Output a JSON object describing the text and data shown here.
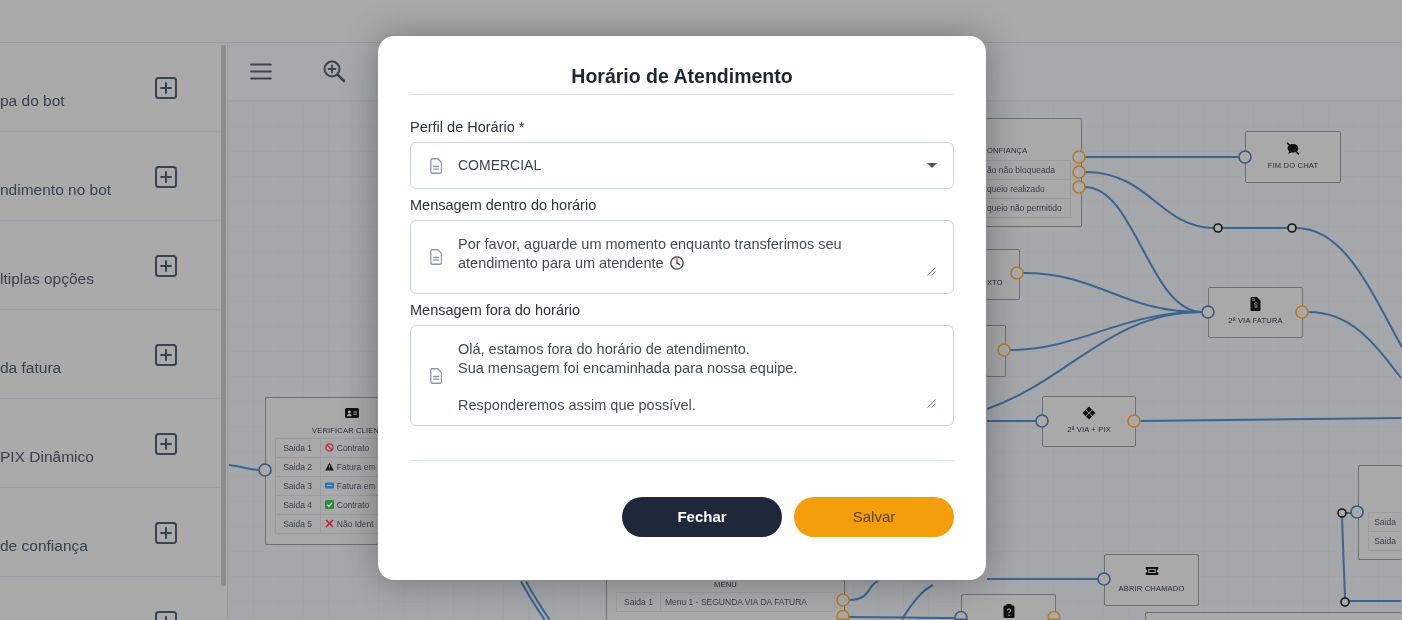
{
  "sidebar": {
    "items": [
      {
        "label": "pa do bot",
        "add_button": true
      },
      {
        "label": "ndimento no bot",
        "add_button": true
      },
      {
        "label": "ltiplas opções",
        "add_button": true
      },
      {
        "label": "da fatura",
        "add_button": true
      },
      {
        "label": "PIX Dinâmico",
        "add_button": true
      },
      {
        "label": "de confiança",
        "add_button": true
      },
      {
        "add_button": true
      }
    ]
  },
  "diagram": {
    "nodes": [
      {
        "kind": "table",
        "title": "ONFIANÇA",
        "rows": [
          {
            "text": "ão não bloqueada"
          },
          {
            "text": "queio realizado"
          },
          {
            "text": "queio não permitido"
          }
        ]
      },
      {
        "kind": "action",
        "title": "FIM DO CHAT"
      },
      {
        "kind": "action",
        "title": "XTO"
      },
      {
        "kind": "action",
        "title": "2ª VIA FATURA"
      },
      {
        "kind": "action"
      },
      {
        "kind": "table",
        "title": "VERIFICAR CLIEN",
        "rows": [
          {
            "output": "Saida 1",
            "text": "Contrato"
          },
          {
            "output": "Saida 2",
            "text": "Fatura em"
          },
          {
            "output": "Saida 3",
            "text": "Fatura em"
          },
          {
            "output": "Saida 4",
            "text": "Contrato"
          },
          {
            "output": "Saida 5",
            "text": "Não Ident"
          }
        ]
      },
      {
        "kind": "action",
        "title": "2ª VIA + PIX"
      },
      {
        "kind": "table",
        "rows": [
          {
            "output": "Saida"
          },
          {
            "output": "Saida"
          }
        ]
      },
      {
        "kind": "action",
        "title": "ABRIR CHAMADO"
      },
      {
        "kind": "table",
        "title": "MENU",
        "rows": [
          {
            "output": "Saida 1",
            "text": "Menu 1 - SEGUNDA VIA DA FATURA"
          }
        ]
      },
      {
        "kind": "action"
      },
      {
        "kind": "action"
      }
    ]
  },
  "modal": {
    "title": "Horário de Atendimento",
    "fields": [
      {
        "kind": "select",
        "label": "Perfil de Horário *",
        "value": "COMERCIAL"
      },
      {
        "kind": "textarea",
        "label": "Mensagem dentro do horário",
        "value": "Por favor, aguarde um momento enquanto transferimos seu atendimento para um atendente",
        "clock_emoji": true
      },
      {
        "kind": "textarea",
        "label": "Mensagem fora do horário",
        "value": "Olá, estamos fora do horário de atendimento.\nSua mensagem foi encaminhada para nossa equipe.\n\nResponderemos assim que possível.",
        "clock_emoji": false
      }
    ],
    "buttons": [
      {
        "kind": "close",
        "label": "Fechar"
      },
      {
        "kind": "save",
        "label": "Salvar"
      }
    ]
  }
}
